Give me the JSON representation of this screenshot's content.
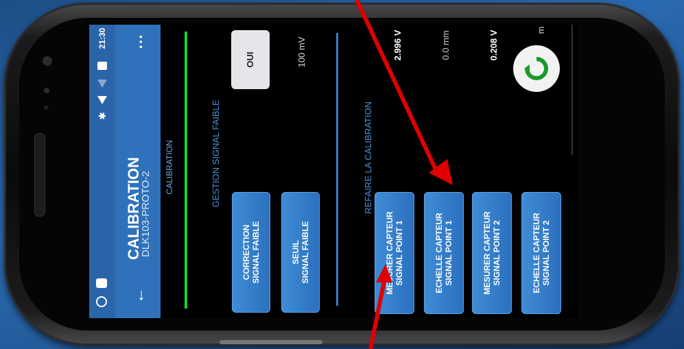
{
  "status_bar": {
    "time": "21:30"
  },
  "app_bar": {
    "title": "CALIBRATION",
    "subtitle": "DLK103-PROTO-2",
    "back_icon": "arrow-back-icon",
    "menu_icon": "more-vert-icon"
  },
  "tab": {
    "label": "CALIBRATION"
  },
  "section_signal": {
    "title": "GESTION SIGNAL FAIBLE",
    "correction_button": "CORRECTION\nSIGNAL FAIBLE",
    "seuil_button": "SEUIL\nSIGNAL FAIBLE",
    "oui_button": "OUI",
    "seuil_value": "100 mV"
  },
  "section_calibration": {
    "title": "REFAIRE LA CALIBRATION",
    "buttons": [
      "MESURER CAPTEUR\nSIGNAL POINT 1",
      "ECHELLE CAPTEUR\nSIGNAL POINT 1",
      "MESURER CAPTEUR\nSIGNAL POINT 2",
      "ECHELLE CAPTEUR\nSIGNAL POINT 2"
    ],
    "values": [
      "2.996 V",
      "0.0 mm",
      "0.208 V",
      "m"
    ]
  },
  "colors": {
    "app_bar": "#2f71bb",
    "green_line": "#22cc33",
    "blue_line": "#3a7fc8",
    "button": "#3a86d1",
    "arrow": "#e00000"
  }
}
